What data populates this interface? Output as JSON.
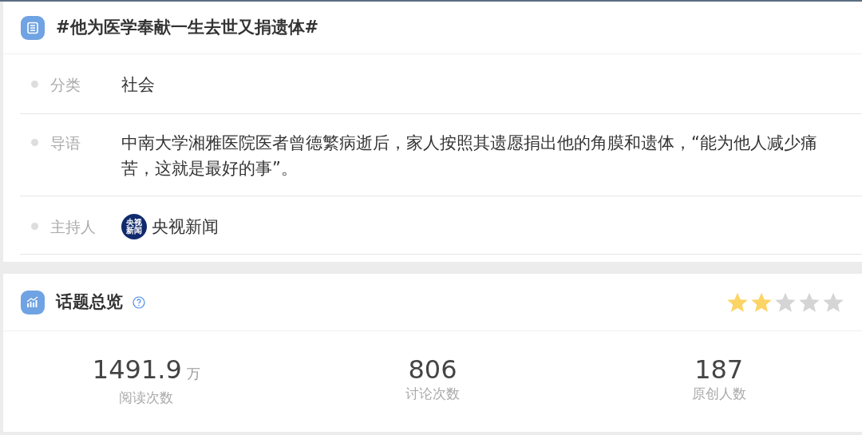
{
  "topic": {
    "title": "#他为医学奉献一生去世又捐遗体#",
    "fields": [
      {
        "label": "分类",
        "value": "社会"
      },
      {
        "label": "导语",
        "value": "中南大学湘雅医院医者曾德繁病逝后，家人按照其遗愿捐出他的角膜和遗体，“能为他人减少痛苦，这就是最好的事”。"
      },
      {
        "label": "主持人",
        "value": "央视新闻",
        "kind": "host",
        "avatar_text": "央视新闻"
      }
    ]
  },
  "overview": {
    "title": "话题总览",
    "stars": 2,
    "stats": [
      {
        "value": "1491.9",
        "unit": "万",
        "label": "阅读次数"
      },
      {
        "value": "806",
        "label": "讨论次数"
      },
      {
        "value": "187",
        "label": "原创人数"
      }
    ]
  }
}
